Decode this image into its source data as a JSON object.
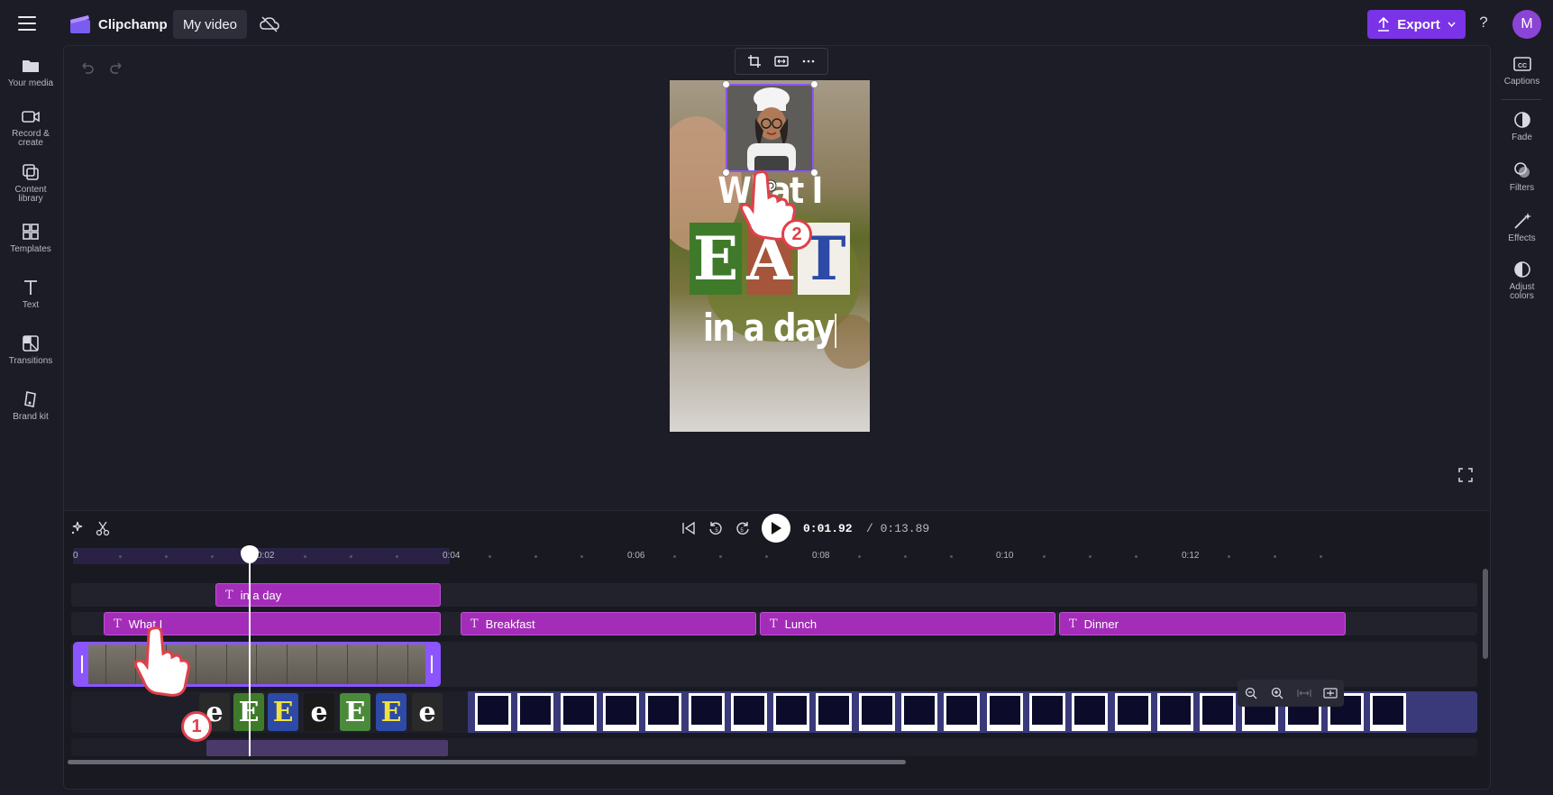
{
  "app": {
    "name": "Clipchamp",
    "project_title": "My video"
  },
  "header": {
    "export_label": "Export",
    "help_glyph": "?",
    "avatar_initial": "M"
  },
  "left_nav": [
    {
      "label": "Your media",
      "icon": "folder-icon"
    },
    {
      "label": "Record & create",
      "icon": "camera-icon"
    },
    {
      "label": "Content library",
      "icon": "library-icon"
    },
    {
      "label": "Templates",
      "icon": "templates-icon"
    },
    {
      "label": "Text",
      "icon": "text-icon"
    },
    {
      "label": "Transitions",
      "icon": "transitions-icon"
    },
    {
      "label": "Brand kit",
      "icon": "brand-kit-icon"
    }
  ],
  "right_nav": [
    {
      "label": "Captions",
      "icon": "captions-icon"
    },
    {
      "label": "Fade",
      "icon": "fade-icon"
    },
    {
      "label": "Filters",
      "icon": "filters-icon"
    },
    {
      "label": "Effects",
      "icon": "effects-icon"
    },
    {
      "label": "Adjust colors",
      "icon": "adjust-colors-icon"
    }
  ],
  "canvas": {
    "title_line1": "What I",
    "eat_letters": [
      {
        "char": "E",
        "color": "#ffffff",
        "bg": "#3f7a2a"
      },
      {
        "char": "A",
        "color": "#ffffff",
        "bg": "#a5553a"
      },
      {
        "char": "T",
        "color": "#2c4aa6",
        "bg": "#f2efe8"
      }
    ],
    "title_line3": "in a day"
  },
  "playback": {
    "current": "0:01.92",
    "total": "/ 0:13.89"
  },
  "ruler": {
    "labels": [
      "0",
      "0:02",
      "0:04",
      "0:06",
      "0:08",
      "0:10",
      "0:12"
    ]
  },
  "tracks": {
    "text_top": [
      {
        "label": "in a day"
      }
    ],
    "text_main": [
      {
        "label": "What I"
      },
      {
        "label": "Breakfast"
      },
      {
        "label": "Lunch"
      },
      {
        "label": "Dinner"
      }
    ],
    "letter_tiles": [
      "e",
      "E",
      "E",
      "e",
      "E",
      "E",
      "e"
    ]
  },
  "steps": {
    "one": "1",
    "two": "2"
  },
  "colors": {
    "accent": "#7b33e8",
    "text_clip": "#a32db8",
    "selection": "#8b55ff"
  }
}
